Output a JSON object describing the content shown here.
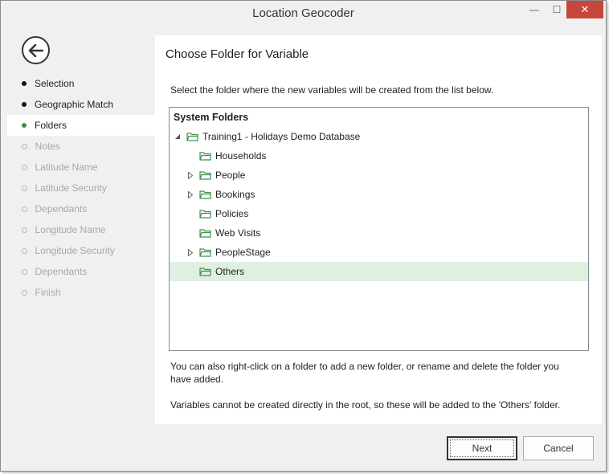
{
  "window": {
    "title": "Location Geocoder",
    "minimize_glyph": "—",
    "maximize_glyph": "☐",
    "close_glyph": "✕"
  },
  "sidebar": {
    "back_icon": "arrow-left-circle-icon",
    "steps": [
      {
        "label": "Selection",
        "state": "done"
      },
      {
        "label": "Geographic Match",
        "state": "done"
      },
      {
        "label": "Folders",
        "state": "active"
      },
      {
        "label": "Notes",
        "state": "pending"
      },
      {
        "label": "Latitude Name",
        "state": "pending"
      },
      {
        "label": "Latitude Security",
        "state": "pending"
      },
      {
        "label": "Dependants",
        "state": "pending"
      },
      {
        "label": "Longitude Name",
        "state": "pending"
      },
      {
        "label": "Longitude Security",
        "state": "pending"
      },
      {
        "label": "Dependants",
        "state": "pending"
      },
      {
        "label": "Finish",
        "state": "pending"
      }
    ]
  },
  "main": {
    "heading": "Choose Folder for Variable",
    "instruction": "Select the folder where the new variables will be created from the list below.",
    "tree": {
      "header": "System Folders",
      "root": {
        "label": "Training1 - Holidays Demo Database",
        "expanded": true
      },
      "folders": [
        {
          "label": "Households",
          "expandable": false
        },
        {
          "label": "People",
          "expandable": true
        },
        {
          "label": "Bookings",
          "expandable": true
        },
        {
          "label": "Policies",
          "expandable": false
        },
        {
          "label": "Web Visits",
          "expandable": false
        },
        {
          "label": "PeopleStage",
          "expandable": true
        },
        {
          "label": "Others",
          "expandable": false,
          "selected": true
        }
      ]
    },
    "note1": "You can also right-click on a folder to add a new folder, or rename and delete the folder you have added.",
    "note2": "Variables cannot be created directly in the root, so these will be added to the 'Others' folder."
  },
  "buttons": {
    "next": "Next",
    "cancel": "Cancel"
  },
  "colors": {
    "accent_green": "#3f8f4e",
    "selection": "#dff0e2",
    "close_red": "#c7463c"
  }
}
